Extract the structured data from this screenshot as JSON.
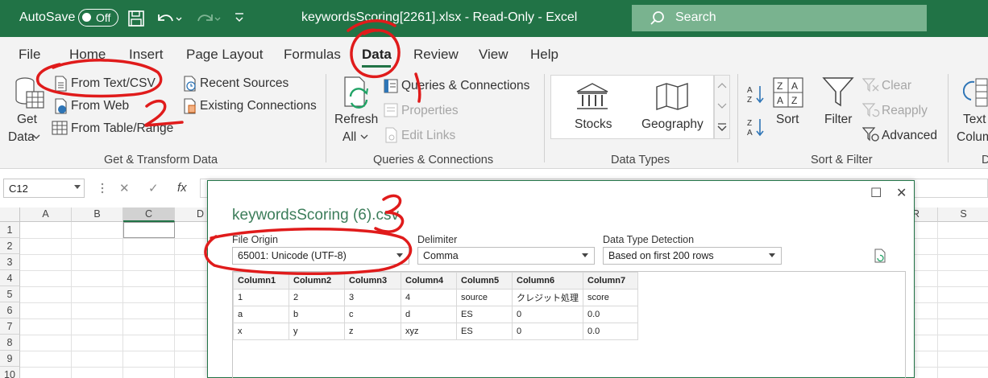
{
  "titlebar": {
    "autosave_label": "AutoSave",
    "autosave_state": "Off",
    "doc_title": "keywordsScoring[2261].xlsx  -  Read-Only  -  Excel",
    "search_placeholder": "Search"
  },
  "menu": {
    "tabs": [
      "File",
      "Home",
      "Insert",
      "Page Layout",
      "Formulas",
      "Data",
      "Review",
      "View",
      "Help"
    ],
    "active": "Data"
  },
  "ribbon": {
    "get_data": [
      "Get",
      "Data"
    ],
    "from_text_csv": "From Text/CSV",
    "from_web": "From Web",
    "from_table_range": "From Table/Range",
    "recent_sources": "Recent Sources",
    "existing_connections": "Existing Connections",
    "group_get_transform": "Get & Transform Data",
    "refresh_all": [
      "Refresh",
      "All"
    ],
    "queries_connections": "Queries & Connections",
    "properties": "Properties",
    "edit_links": "Edit Links",
    "group_queries": "Queries & Connections",
    "stocks": "Stocks",
    "geography": "Geography",
    "group_data_types": "Data Types",
    "sort": "Sort",
    "filter": "Filter",
    "clear": "Clear",
    "reapply": "Reapply",
    "advanced": "Advanced",
    "group_sort_filter": "Sort & Filter",
    "text_to_columns": [
      "Text to",
      "Colum"
    ],
    "group_partial": "D"
  },
  "formula_bar": {
    "name_box": "C12",
    "cancel": "✕",
    "enter": "✓",
    "fx": "fx"
  },
  "grid": {
    "columns_left": [
      "A",
      "B",
      "C",
      "D"
    ],
    "columns_right": [
      "R",
      "S"
    ],
    "rows": [
      "1",
      "2",
      "3",
      "4",
      "5",
      "6",
      "7",
      "8",
      "9",
      "10"
    ]
  },
  "dialog": {
    "title": "keywordsScoring (6).csv",
    "file_origin_label": "File Origin",
    "file_origin_value": "65001: Unicode (UTF-8)",
    "delimiter_label": "Delimiter",
    "delimiter_value": "Comma",
    "detection_label": "Data Type Detection",
    "detection_value": "Based on first 200 rows",
    "preview_headers": [
      "Column1",
      "Column2",
      "Column3",
      "Column4",
      "Column5",
      "Column6",
      "Column7"
    ],
    "preview_rows": [
      [
        "1",
        "2",
        "3",
        "4",
        "source",
        "クレジット処理",
        "score"
      ],
      [
        "a",
        "b",
        "c",
        "d",
        "ES",
        "0",
        "0.0"
      ],
      [
        "x",
        "y",
        "z",
        "xyz",
        "ES",
        "0",
        "0.0"
      ]
    ]
  },
  "annotations": {
    "marks": [
      "1",
      "2",
      "3"
    ],
    "color": "#e01b1b"
  },
  "colors": {
    "excel_green": "#217346",
    "ribbon_bg": "#f3f3f3"
  }
}
